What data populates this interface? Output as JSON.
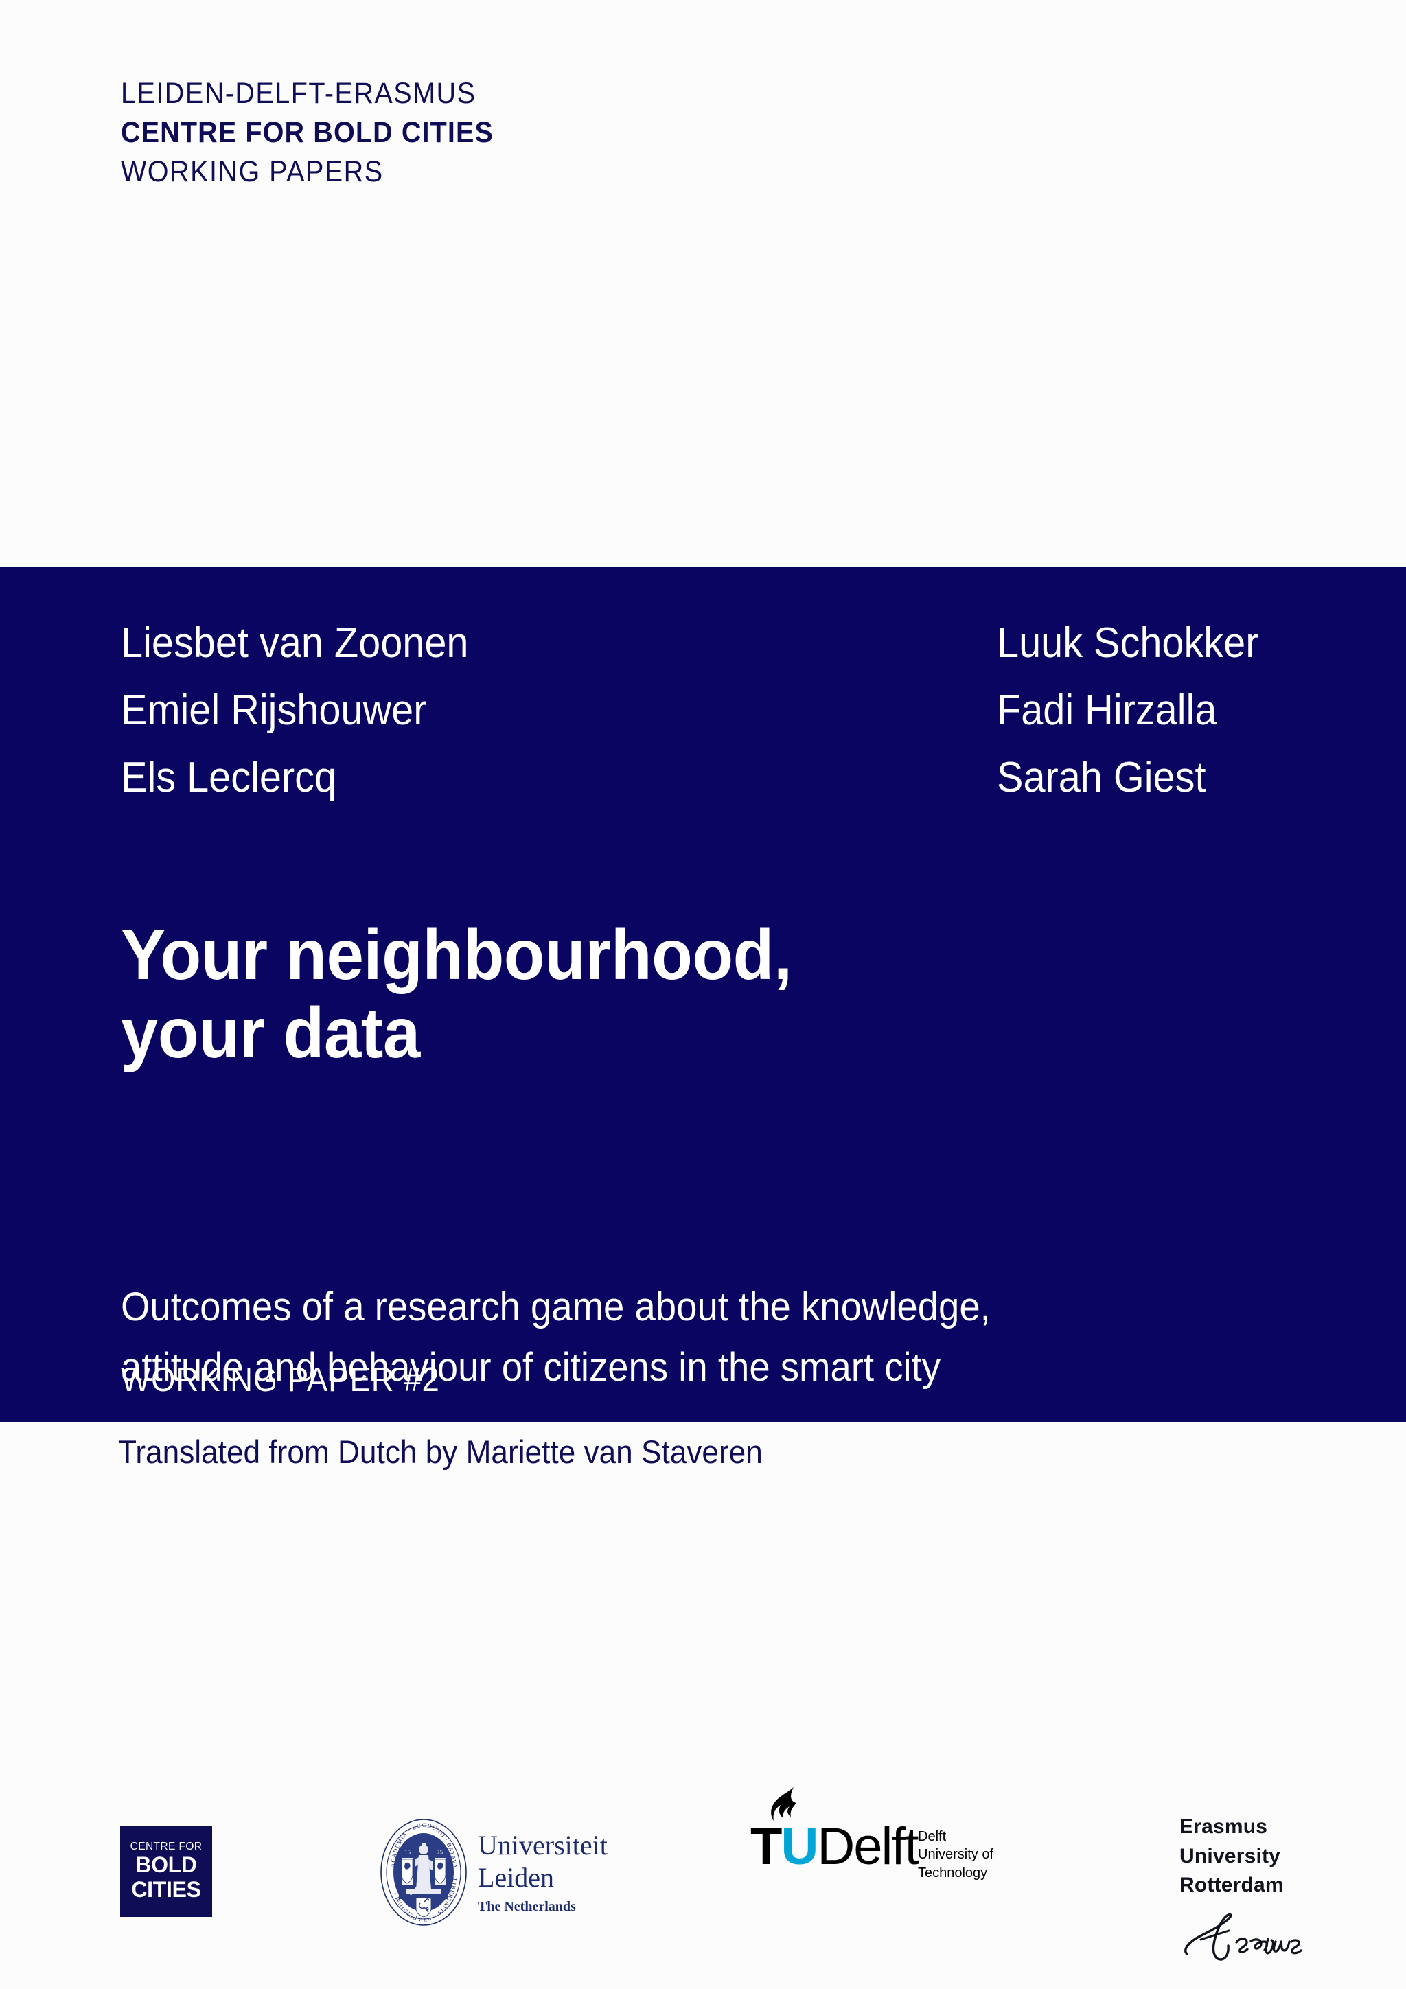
{
  "masthead": {
    "line1": "LEIDEN-DELFT-ERASMUS",
    "line2": "CENTRE FOR BOLD CITIES",
    "line3": "WORKING PAPERS"
  },
  "authors": {
    "left": [
      "Liesbet van Zoonen",
      "Emiel Rijshouwer",
      "Els Leclercq"
    ],
    "right": [
      "Luuk Schokker",
      "Fadi Hirzalla",
      "Sarah Giest"
    ]
  },
  "title": {
    "line1": "Your neighbourhood,",
    "line2": "your data"
  },
  "subtitle": {
    "line1": "Outcomes of a research game about the knowledge,",
    "line2": "attitude and behaviour of citizens in the smart city"
  },
  "paper_number": "WORKING PAPER #2",
  "translator_note": "Translated from Dutch by Mariette van Staveren",
  "logos": {
    "bold_cities": {
      "top": "CENTRE FOR",
      "mid": "BOLD",
      "bottom": "CITIES"
    },
    "leiden": {
      "line1": "Universiteit",
      "line2": "Leiden",
      "line3": "The Netherlands",
      "seal_text": "ACADEMIA LUGDUNO BATAVA LIBERTATIS PRAESIDIUM",
      "seal_year_left": "15",
      "seal_year_right": "75"
    },
    "tudelft": {
      "t": "T",
      "u": "U",
      "delft": "Delft",
      "sub1": "Delft",
      "sub2": "University of",
      "sub3": "Technology"
    },
    "erasmus": {
      "line1": "Erasmus",
      "line2": "University",
      "line3": "Rotterdam",
      "signature": "Erasmus"
    }
  },
  "colors": {
    "navy": "#0a0560",
    "text_navy": "#0f0d56",
    "leiden_blue": "#1c2b6b",
    "delft_cyan": "#00a6d6",
    "page_background": "#fcfcfd"
  }
}
